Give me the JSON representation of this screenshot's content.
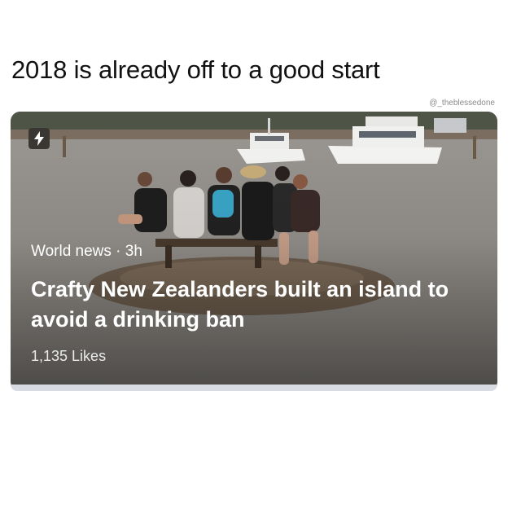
{
  "post": {
    "caption": "2018 is already off to a good start",
    "watermark": "@_theblessedone"
  },
  "card": {
    "badge_icon": "lightning-bolt-icon",
    "category": "World news",
    "separator": " · ",
    "age": "3h",
    "headline": "Crafty New Zealanders built an island to avoid a drinking ban",
    "likes": "1,135 Likes"
  },
  "colors": {
    "text_dark": "#111111",
    "card_text": "#ffffff",
    "badge_bg": "#3a3634"
  }
}
